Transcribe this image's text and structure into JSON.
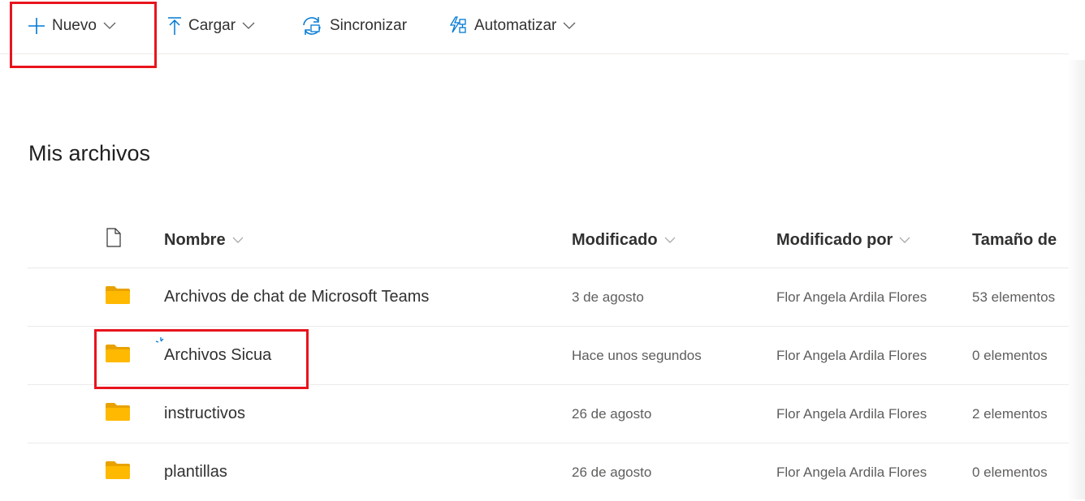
{
  "command_bar": {
    "new_label": "Nuevo",
    "upload_label": "Cargar",
    "sync_label": "Sincronizar",
    "automate_label": "Automatizar"
  },
  "page": {
    "title": "Mis archivos"
  },
  "table": {
    "columns": {
      "name": "Nombre",
      "modified": "Modificado",
      "modified_by": "Modificado por",
      "size": "Tamaño de"
    },
    "rows": [
      {
        "name": "Archivos de chat de Microsoft Teams",
        "modified": "3 de agosto",
        "modified_by": "Flor Angela Ardila Flores",
        "size": "53 elementos"
      },
      {
        "name": "Archivos Sicua",
        "modified": "Hace unos segundos",
        "modified_by": "Flor Angela Ardila Flores",
        "size": "0 elementos"
      },
      {
        "name": "instructivos",
        "modified": "26 de agosto",
        "modified_by": "Flor Angela Ardila Flores",
        "size": "2 elementos"
      },
      {
        "name": "plantillas",
        "modified": "26 de agosto",
        "modified_by": "Flor Angela Ardila Flores",
        "size": "0 elementos"
      }
    ]
  },
  "colors": {
    "accent": "#0078d4",
    "folder": "#ffb900",
    "folder_dark": "#e8a200",
    "highlight": "#e8141d"
  },
  "icons": {
    "new": "plus-icon",
    "upload": "upload-arrow-icon",
    "sync": "sync-icon",
    "automate": "flow-icon",
    "file_type": "document-icon",
    "folder": "folder-icon"
  }
}
